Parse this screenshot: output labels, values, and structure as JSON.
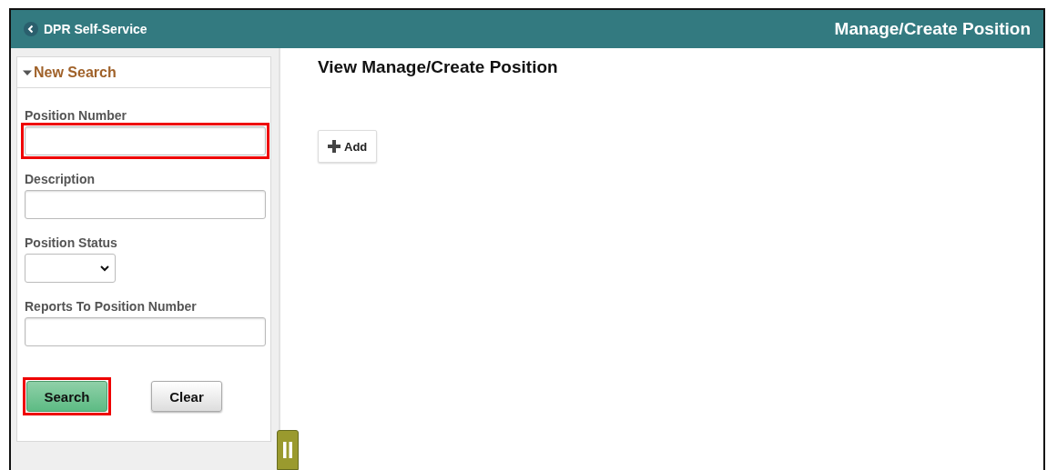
{
  "header": {
    "back_label": "DPR Self-Service",
    "title": "Manage/Create Position"
  },
  "search_panel": {
    "title": "New Search",
    "expanded": true,
    "fields": [
      {
        "kind": "text",
        "label": "Position Number",
        "highlighted": true
      },
      {
        "kind": "text",
        "label": "Description",
        "highlighted": false
      },
      {
        "kind": "select",
        "label": "Position Status",
        "highlighted": false
      },
      {
        "kind": "text",
        "label": "Reports To Position Number",
        "highlighted": false
      }
    ],
    "buttons": [
      {
        "kind": "primary",
        "label": "Search",
        "highlighted": true
      },
      {
        "kind": "secondary",
        "label": "Clear",
        "highlighted": false
      }
    ]
  },
  "main": {
    "heading": "View Manage/Create Position",
    "add_button": "Add"
  }
}
